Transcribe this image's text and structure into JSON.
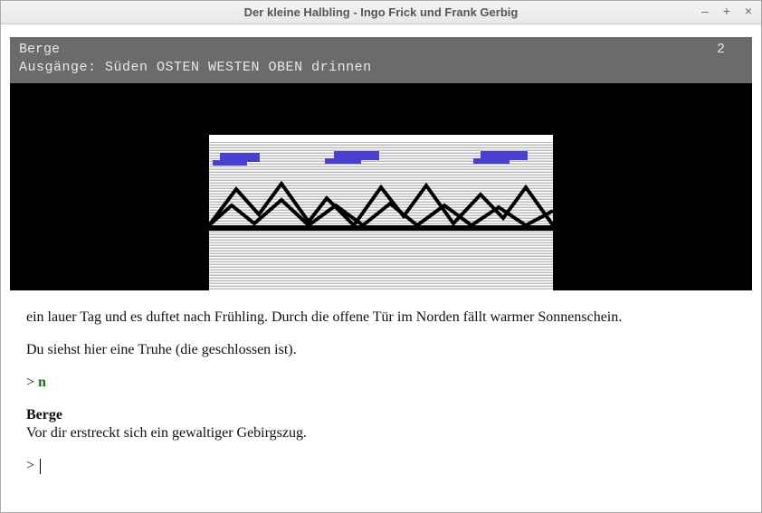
{
  "window": {
    "title": "Der kleine Halbling - Ingo Frick und Frank Gerbig"
  },
  "status": {
    "location": "Berge",
    "turns": "2",
    "exits_label": "Ausgänge:",
    "exits": "Süden OSTEN  WESTEN  OBEN  drinnen"
  },
  "text": {
    "p1": "ein lauer Tag und es duftet nach Frühling. Durch die offene Tür im Norden fällt warmer Sonnenschein.",
    "p2": "Du siehst hier eine Truhe (die geschlossen ist).",
    "prev_prompt": ">",
    "prev_cmd": "n",
    "location_heading": "Berge",
    "location_desc": "Vor dir erstreckt sich ein gewaltiger Gebirgszug.",
    "prompt": ">"
  }
}
